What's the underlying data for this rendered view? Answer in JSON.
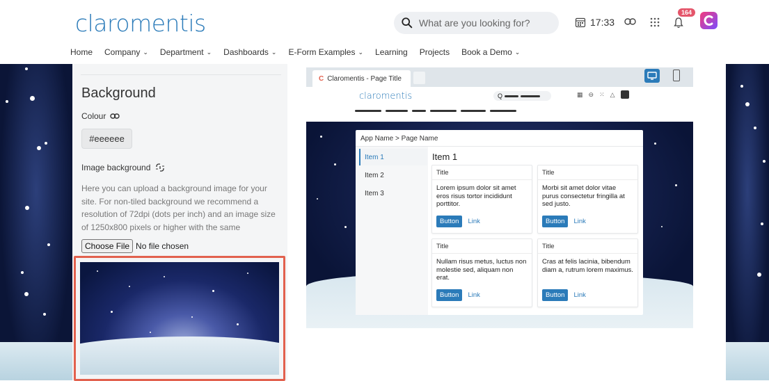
{
  "header": {
    "logo": "claromentis",
    "search_placeholder": "What are you looking for?",
    "time": "17:33",
    "notification_count": "164",
    "nav": [
      {
        "label": "Home",
        "dropdown": false
      },
      {
        "label": "Company",
        "dropdown": true
      },
      {
        "label": "Department",
        "dropdown": true
      },
      {
        "label": "Dashboards",
        "dropdown": true
      },
      {
        "label": "E-Form Examples",
        "dropdown": true
      },
      {
        "label": "Learning",
        "dropdown": false
      },
      {
        "label": "Projects",
        "dropdown": false
      },
      {
        "label": "Book a Demo",
        "dropdown": true
      }
    ]
  },
  "panel": {
    "heading": "Background",
    "colour_label": "Colour",
    "colour_value": "#eeeeee",
    "image_label": "Image background",
    "help_text": "Here you can upload a background image for your site. For non-tiled background we recommend a resolution of 72dpi (dots per inch) and an image size of 1250x800 pixels or higher with the same",
    "choose_file": "Choose File",
    "no_file": "No file chosen"
  },
  "preview": {
    "tab_title": "Claromentis - Page Title",
    "logo": "claromentis",
    "breadcrumb": "App Name  >  Page Name",
    "side_items": [
      "Item 1",
      "Item 2",
      "Item 3"
    ],
    "main_heading": "Item 1",
    "tiles": [
      {
        "title": "Title",
        "body": "Lorem ipsum dolor sit amet eros risus tortor incididunt porttitor.",
        "button": "Button",
        "link": "Link"
      },
      {
        "title": "Title",
        "body": "Morbi sit amet dolor vitae purus consectetur fringilla at sed justo.",
        "button": "Button",
        "link": "Link"
      },
      {
        "title": "Title",
        "body": "Nullam risus metus, luctus non molestie sed, aliquam non erat.",
        "button": "Button",
        "link": "Link"
      },
      {
        "title": "Title",
        "body": "Cras at felis lacinia, bibendum diam a, rutrum lorem maximus.",
        "button": "Button",
        "link": "Link"
      }
    ]
  },
  "colors": {
    "brand": "#2b7bb9",
    "highlight_border": "#e2614e",
    "badge": "#e4556a"
  }
}
